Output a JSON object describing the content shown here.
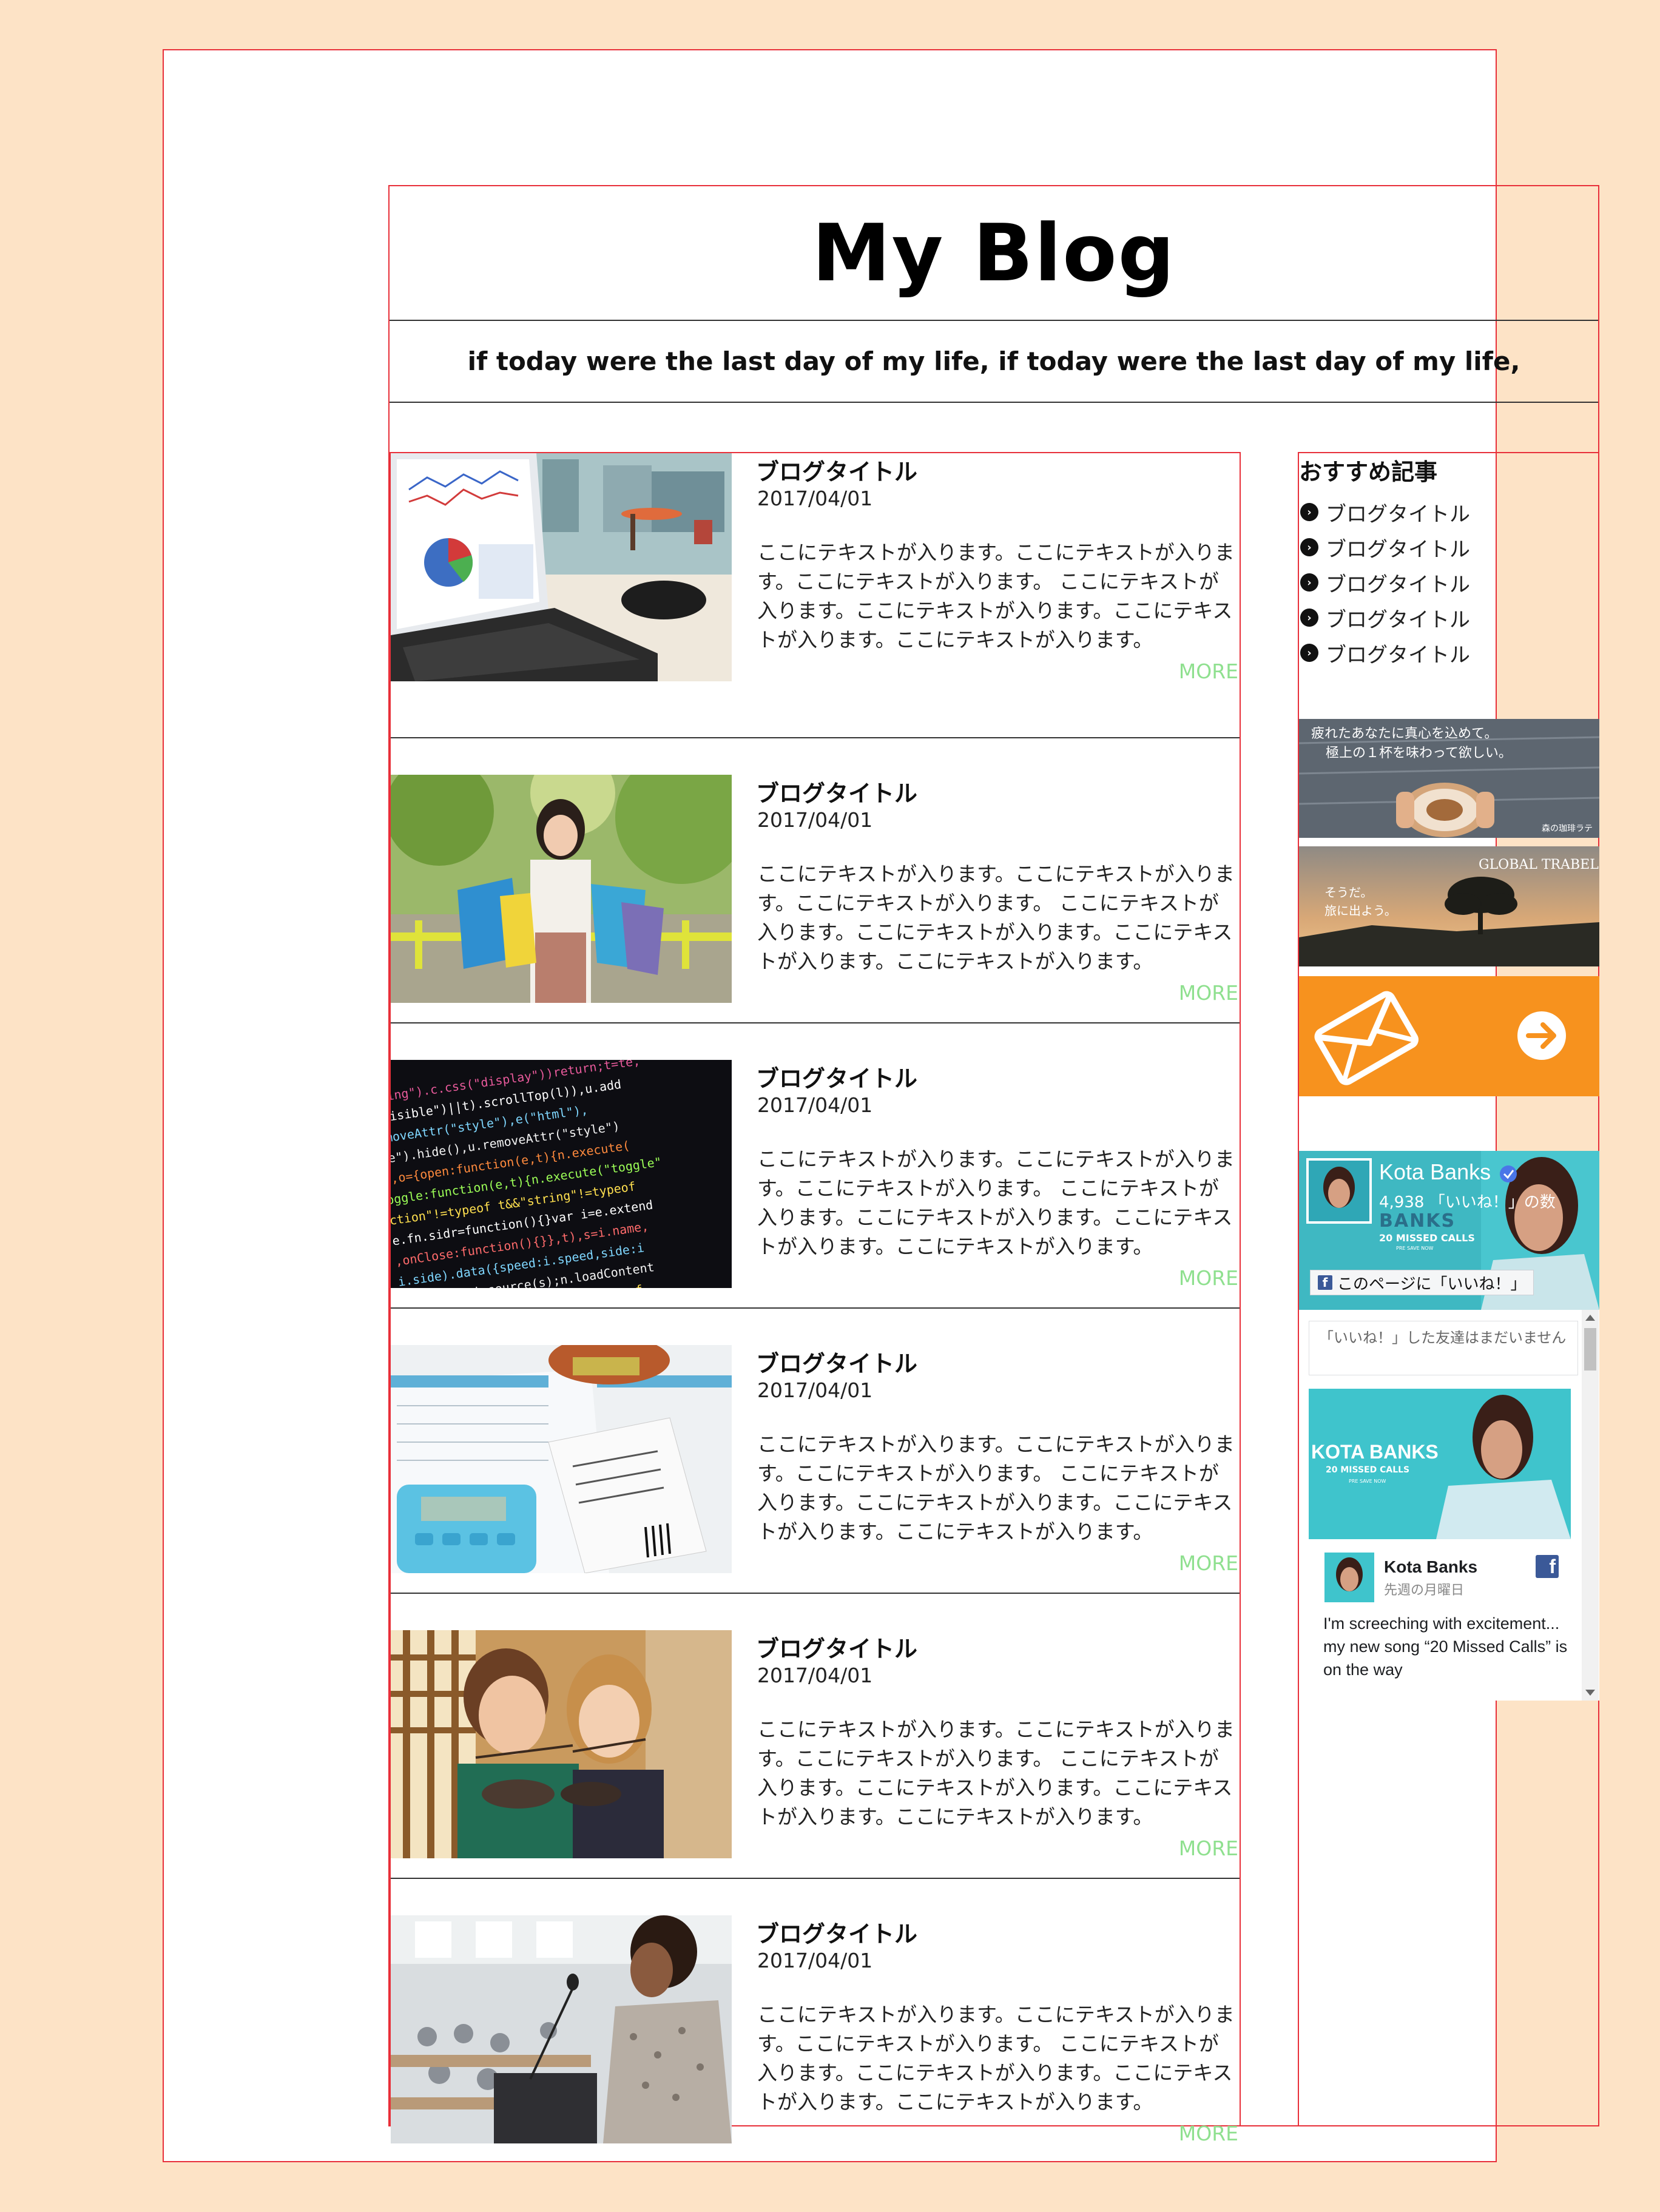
{
  "header": {
    "title": "My Blog"
  },
  "tagline": "if today were the last day of my life, if today were the last day of my life,",
  "posts": [
    {
      "title": "ブログタイトル",
      "date": "2017/04/01",
      "excerpt": "ここにテキストが入ります。ここにテキストが入ります。ここにテキストが入ります。 ここにテキストが入ります。ここにテキストが入ります。ここにテキストが入ります。ここにテキストが入ります。",
      "more": "MORE",
      "image": "laptop-chart"
    },
    {
      "title": "ブログタイトル",
      "date": "2017/04/01",
      "excerpt": "ここにテキストが入ります。ここにテキストが入ります。ここにテキストが入ります。 ここにテキストが入ります。ここにテキストが入ります。ここにテキストが入ります。ここにテキストが入ります。",
      "more": "MORE",
      "image": "shopping-woman"
    },
    {
      "title": "ブログタイトル",
      "date": "2017/04/01",
      "excerpt": "ここにテキストが入ります。ここにテキストが入ります。ここにテキストが入ります。 ここにテキストが入ります。ここにテキストが入ります。ここにテキストが入ります。ここにテキストが入ります。",
      "more": "MORE",
      "image": "source-code"
    },
    {
      "title": "ブログタイトル",
      "date": "2017/04/01",
      "excerpt": "ここにテキストが入ります。ここにテキストが入ります。ここにテキストが入ります。 ここにテキストが入ります。ここにテキストが入ります。ここにテキストが入ります。ここにテキストが入ります。",
      "more": "MORE",
      "image": "household-budget"
    },
    {
      "title": "ブログタイトル",
      "date": "2017/04/01",
      "excerpt": "ここにテキストが入ります。ここにテキストが入ります。ここにテキストが入ります。 ここにテキストが入ります。ここにテキストが入ります。ここにテキストが入ります。ここにテキストが入ります。",
      "more": "MORE",
      "image": "women-eating-noodles"
    },
    {
      "title": "ブログタイトル",
      "date": "2017/04/01",
      "excerpt": "ここにテキストが入ります。ここにテキストが入ります。ここにテキストが入ります。 ここにテキストが入ります。ここにテキストが入ります。ここにテキストが入ります。ここにテキストが入ります。",
      "more": "MORE",
      "image": "speaker-podium"
    }
  ],
  "sidebar": {
    "recommended_title": "おすすめ記事",
    "recommended": [
      "ブログタイトル",
      "ブログタイトル",
      "ブログタイトル",
      "ブログタイトル",
      "ブログタイトル"
    ],
    "banner_coffee": {
      "line1": "疲れたあなたに真心を込めて。",
      "line2": "極上の１杯を味わって欲しい。",
      "sign": "森の珈琲ラテ"
    },
    "banner_travel": {
      "brand": "GLOBAL TRABEL",
      "line1": "そうだ。",
      "line2": "旅に出よう。"
    },
    "mail_banner": {
      "icons": [
        "envelope-icon",
        "arrow-right-circle-icon"
      ],
      "bg_color": "#f7921e"
    },
    "facebook": {
      "page_name": "Kota Banks",
      "likes": "4,938 「いいね！」の数",
      "like_button": "このページに「いいね！」",
      "friends_text": "「いいね！」した友達はまだいません",
      "cover_text": "BANKS",
      "cover_sub": "20 MISSED CALLS",
      "cover_note": "PRE SAVE NOW",
      "post_image_title": "KOTA BANKS",
      "post_image_sub": "20 MISSED CALLS",
      "post_image_note": "PRE SAVE NOW",
      "post_author": "Kota Banks",
      "post_date": "先週の月曜日",
      "post_text": "I'm screeching with excitement... my new song “20 Missed Calls” is on the way"
    }
  }
}
